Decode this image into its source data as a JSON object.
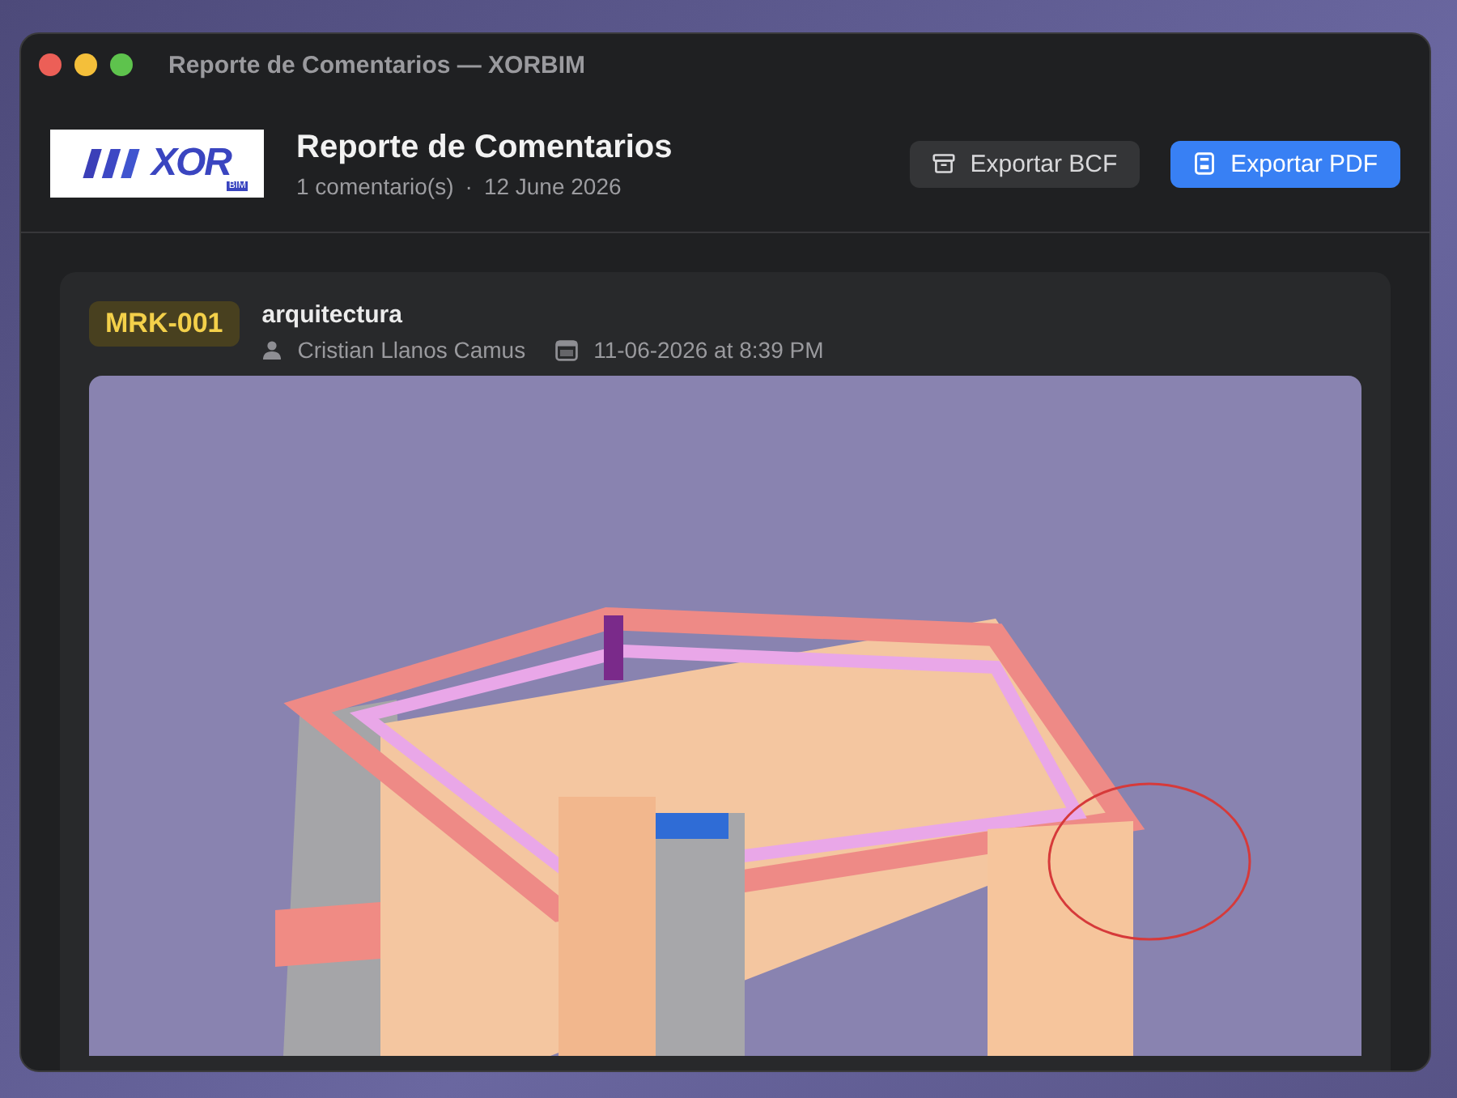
{
  "window": {
    "title": "Reporte de Comentarios — XORBIM"
  },
  "header": {
    "logo_text": "XOR",
    "logo_subtext": "BIM",
    "title": "Reporte de Comentarios",
    "count": "1 comentario(s)",
    "separator": "·",
    "date": "12 June 2026"
  },
  "buttons": [
    {
      "label": "Exportar BCF",
      "kind": "secondary"
    },
    {
      "label": "Exportar PDF",
      "kind": "primary"
    }
  ],
  "comments": [
    {
      "id": "MRK-001",
      "discipline": "arquitectura",
      "author": "Cristian Llanos Camus",
      "timestamp": "11-06-2026 at 8:39 PM"
    }
  ]
}
